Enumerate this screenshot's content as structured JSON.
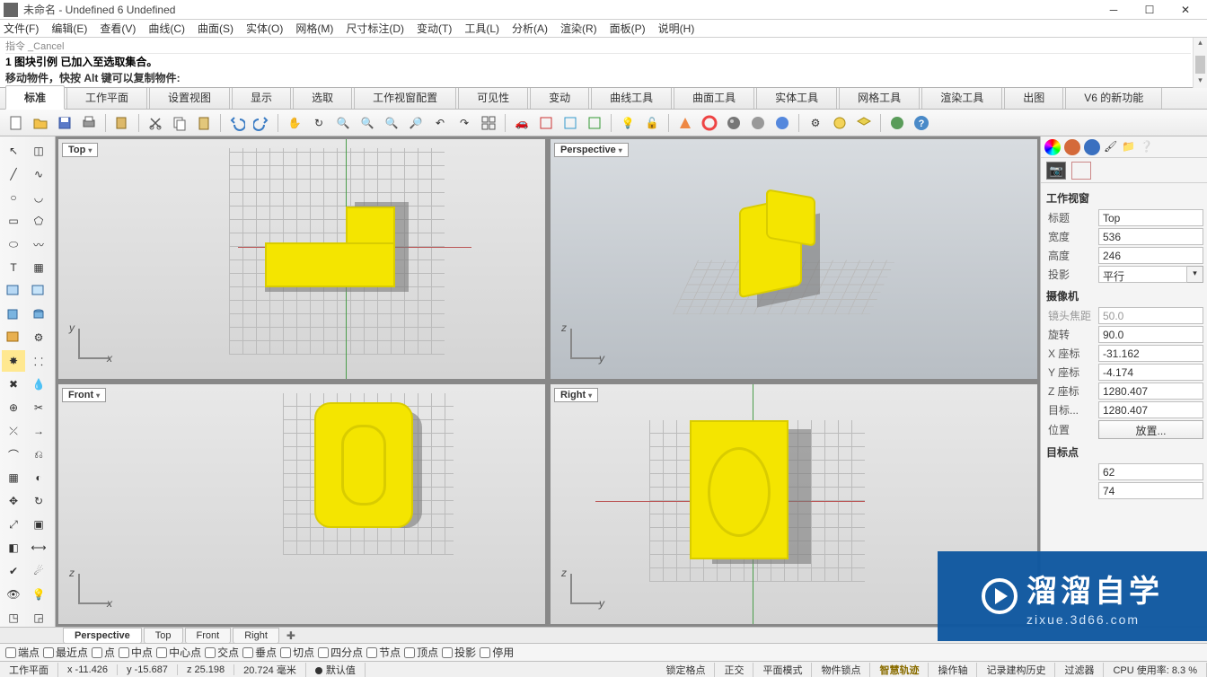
{
  "title": "未命名 - Undefined 6 Undefined",
  "menus": [
    "文件(F)",
    "编辑(E)",
    "查看(V)",
    "曲线(C)",
    "曲面(S)",
    "实体(O)",
    "网格(M)",
    "尺寸标注(D)",
    "变动(T)",
    "工具(L)",
    "分析(A)",
    "渲染(R)",
    "面板(P)",
    "说明(H)"
  ],
  "cmd_history": "1 图块引例 已加入至选取集合。",
  "cmd_prompt": "移动物件，快按 Alt 键可以复制物件:",
  "tabs": [
    "标准",
    "工作平面",
    "设置视图",
    "显示",
    "选取",
    "工作视窗配置",
    "可见性",
    "变动",
    "曲线工具",
    "曲面工具",
    "实体工具",
    "网格工具",
    "渲染工具",
    "出图",
    "V6 的新功能"
  ],
  "tabs_active": 0,
  "viewports": {
    "top": "Top",
    "persp": "Perspective",
    "front": "Front",
    "right": "Right"
  },
  "vp_tabs": [
    "Perspective",
    "Top",
    "Front",
    "Right"
  ],
  "vp_tabs_active": 0,
  "panel": {
    "sec1": "工作视窗",
    "title_l": "标题",
    "title_v": "Top",
    "width_l": "宽度",
    "width_v": "536",
    "height_l": "高度",
    "height_v": "246",
    "proj_l": "投影",
    "proj_v": "平行",
    "sec2": "摄像机",
    "lens_l": "镜头焦距",
    "lens_v": "50.0",
    "rot_l": "旋转",
    "rot_v": "90.0",
    "x_l": "X 座标",
    "x_v": "-31.162",
    "y_l": "Y 座标",
    "y_v": "-4.174",
    "z_l": "Z 座标",
    "z_v": "1280.407",
    "tgt_l": "目标...",
    "tgt_v": "1280.407",
    "pos_l": "位置",
    "pos_btn": "放置...",
    "sec3": "目标点",
    "extra1_v": "62",
    "extra2_v": "74"
  },
  "osnaps": [
    "端点",
    "最近点",
    "点",
    "中点",
    "中心点",
    "交点",
    "垂点",
    "切点",
    "四分点",
    "节点",
    "顶点",
    "投影",
    "停用"
  ],
  "status": {
    "s1": "工作平面",
    "x": "x -11.426",
    "y": "y -15.687",
    "z": "z 25.198",
    "mm": "20.724 毫米",
    "layer": "默认值",
    "items": [
      "锁定格点",
      "正交",
      "平面模式",
      "物件锁点",
      "智慧轨迹",
      "操作轴",
      "记录建构历史",
      "过滤器"
    ],
    "cpu": "CPU 使用率: 8.3 %"
  },
  "watermark": {
    "big": "溜溜自学",
    "small": "zixue.3d66.com"
  }
}
